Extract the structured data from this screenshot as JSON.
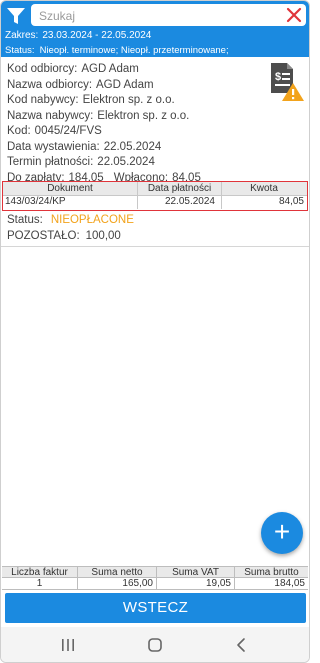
{
  "header": {
    "search_placeholder": "Szukaj",
    "range_label": "Zakres:",
    "range_value": "23.03.2024  -  22.05.2024",
    "status_label": "Status:",
    "status_value": "Nieopł. terminowe; Nieopł. przeterminowane;"
  },
  "details": {
    "customer_code_label": "Kod odbiorcy:",
    "customer_code": "AGD Adam",
    "customer_name_label": "Nazwa odbiorcy:",
    "customer_name": "AGD Adam",
    "buyer_code_label": "Kod nabywcy:",
    "buyer_code": "Elektron sp. z o.o.",
    "buyer_name_label": "Nazwa nabywcy:",
    "buyer_name": "Elektron sp. z o.o.",
    "code_label": "Kod:",
    "code": "0045/24/FVS",
    "issue_date_label": "Data wystawienia:",
    "issue_date": "22.05.2024",
    "due_date_label": "Termin płatności:",
    "due_date": "22.05.2024",
    "to_pay_label": "Do zapłaty:",
    "to_pay": "184,05",
    "paid_label": "Wpłacono:",
    "paid": "84,05"
  },
  "payments_table": {
    "headers": [
      "Dokument",
      "Data płatności",
      "Kwota"
    ],
    "rows": [
      [
        "143/03/24/KP",
        "22.05.2024",
        "84,05"
      ]
    ]
  },
  "status": {
    "label": "Status:",
    "value": "NIEOPŁACONE",
    "remaining_label": "POZOSTAŁO:",
    "remaining_value": "100,00",
    "status_color": "#f2a31c"
  },
  "summary": {
    "headers": [
      "Liczba faktur",
      "Suma netto",
      "Suma VAT",
      "Suma brutto"
    ],
    "values": [
      "1",
      "165,00",
      "19,05",
      "184,05"
    ]
  },
  "buttons": {
    "back": "WSTECZ"
  },
  "colors": {
    "accent": "#1b8ae0",
    "table_border": "#e0343a"
  },
  "icons": {
    "filter": "filter-icon",
    "clear": "close-icon",
    "document": "invoice-warning-icon",
    "add": "plus-icon",
    "nav_recent": "recent-apps-icon",
    "nav_home": "home-icon",
    "nav_back": "back-icon"
  }
}
